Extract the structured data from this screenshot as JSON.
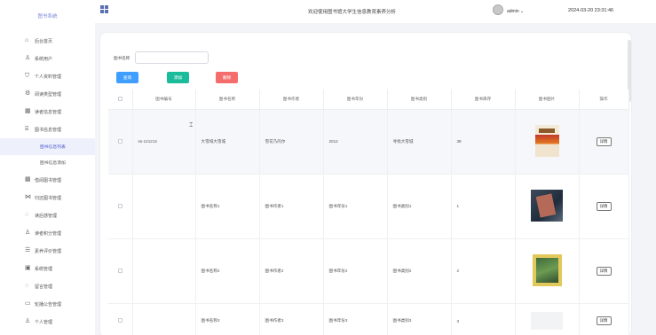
{
  "app": {
    "brand": "图书系统"
  },
  "header": {
    "title": "欢迎使用图书馆大学生信息教育素养分析",
    "user": "admin",
    "datetime": "2024-03-20 23:31:46"
  },
  "sidebar": {
    "items": [
      {
        "label": "后台首页",
        "icon": "home-icon"
      },
      {
        "label": "系统用户",
        "icon": "user-icon"
      },
      {
        "label": "个人资料管理",
        "icon": "shield-icon"
      },
      {
        "label": "阅读类型管理",
        "icon": "gear-icon"
      },
      {
        "label": "读者信息管理",
        "icon": "grid-icon"
      },
      {
        "label": "图书信息管理",
        "icon": "bank-icon"
      },
      {
        "label": "图书信息列表",
        "icon": "",
        "sub": true,
        "active": true
      },
      {
        "label": "图书信息添加",
        "icon": "",
        "sub": true
      },
      {
        "label": "借阅图书管理",
        "icon": "grid-icon"
      },
      {
        "label": "归还图书管理",
        "icon": "share-icon"
      },
      {
        "label": "读后感管理",
        "icon": "chat-icon"
      },
      {
        "label": "读者积分管理",
        "icon": "user-icon"
      },
      {
        "label": "素养评价管理",
        "icon": "list-icon"
      },
      {
        "label": "系统管理",
        "icon": "image-icon"
      },
      {
        "label": "留言管理",
        "icon": "chat-icon"
      },
      {
        "label": "轮播公告管理",
        "icon": "card-icon"
      },
      {
        "label": "个人管理",
        "icon": "user-icon"
      }
    ]
  },
  "search": {
    "label": "图书名称",
    "value": "",
    "placeholder": ""
  },
  "buttons": {
    "query": "查询",
    "add": "添加",
    "delete": "删除"
  },
  "table": {
    "columns": [
      "图书编号",
      "图书名称",
      "图书作者",
      "图书年份",
      "图书类别",
      "图书库存",
      "图书图片",
      "操作"
    ],
    "rows": [
      {
        "id": "ss-121212",
        "name": "大雪域大雪城",
        "author": "雪花乃的尔",
        "year": "2012",
        "category": "寻找大雪城",
        "stock": "38",
        "cover": "cover-1",
        "action": "详情"
      },
      {
        "id": "",
        "name": "图书名称1",
        "author": "图书作者1",
        "year": "图书年份1",
        "category": "图书类别1",
        "stock": "1",
        "cover": "cover-2",
        "action": "详情"
      },
      {
        "id": "",
        "name": "图书名称2",
        "author": "图书作者2",
        "year": "图书年份2",
        "category": "图书类别2",
        "stock": "2",
        "cover": "cover-3",
        "action": "详情"
      },
      {
        "id": "",
        "name": "图书名称3",
        "author": "图书作者3",
        "year": "图书年份3",
        "category": "图书类别3",
        "stock": "3",
        "cover": "cover-4",
        "action": "详情"
      }
    ]
  }
}
